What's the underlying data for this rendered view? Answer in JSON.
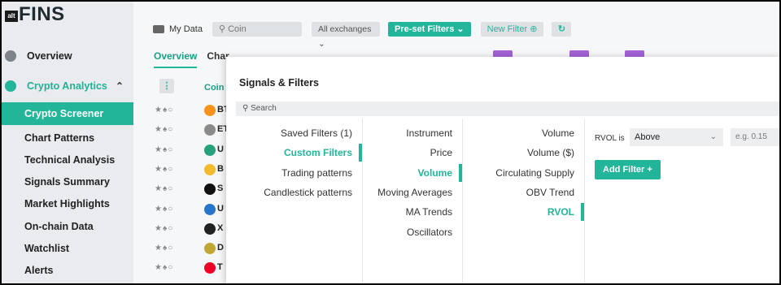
{
  "app": {
    "logo_box": "alt",
    "logo_text": "FINS"
  },
  "sidebar": {
    "items": [
      {
        "label": "Overview"
      },
      {
        "label": "Crypto Analytics"
      },
      {
        "label": "Crypto Screener"
      },
      {
        "label": "Chart Patterns"
      },
      {
        "label": "Technical Analysis"
      },
      {
        "label": "Signals Summary"
      },
      {
        "label": "Market Highlights"
      },
      {
        "label": "On-chain Data"
      },
      {
        "label": "Watchlist"
      },
      {
        "label": "Alerts"
      }
    ]
  },
  "topbar": {
    "my_data": "My Data",
    "search_placeholder": "Coin",
    "exchanges": "All exchanges",
    "preset_filters": "Pre-set Filters",
    "new_filter": "New Filter",
    "reset_icon": "refresh-icon"
  },
  "tabs": {
    "overview": "Overview",
    "charts": "Char"
  },
  "table": {
    "coin_header": "Coin",
    "rows": [
      {
        "sym": "BT",
        "color": "#f7931a"
      },
      {
        "sym": "ET",
        "color": "#8a8a8a"
      },
      {
        "sym": "U",
        "color": "#26a17b"
      },
      {
        "sym": "B",
        "color": "#f3ba2f"
      },
      {
        "sym": "S",
        "color": "#111111"
      },
      {
        "sym": "U",
        "color": "#2775ca"
      },
      {
        "sym": "X",
        "color": "#222222"
      },
      {
        "sym": "D",
        "color": "#c2a633"
      },
      {
        "sym": "T",
        "color": "#ef0027"
      }
    ]
  },
  "modal": {
    "title": "Signals & Filters",
    "search_placeholder": "Search",
    "col1": [
      "Saved Filters (1)",
      "Custom Filters",
      "Trading patterns",
      "Candlestick patterns"
    ],
    "col2": [
      "Instrument",
      "Price",
      "Volume",
      "Moving Averages",
      "MA Trends",
      "Oscillators"
    ],
    "col3": [
      "Volume",
      "Volume ($)",
      "Circulating Supply",
      "OBV Trend",
      "RVOL"
    ],
    "rvol_label": "RVOL is",
    "rvol_condition": "Above",
    "rvol_value_placeholder": "e.g. 0.15",
    "add_filter": "Add Filter  +"
  },
  "colors": {
    "accent": "#22b59a",
    "purple": "#a362d6"
  }
}
